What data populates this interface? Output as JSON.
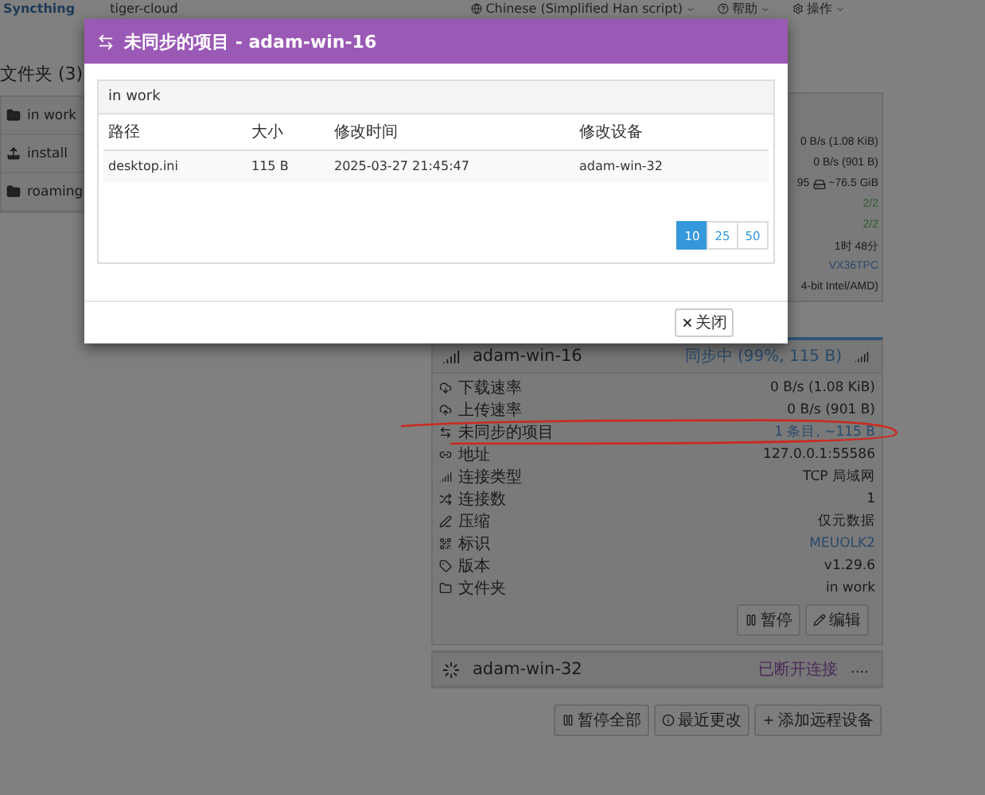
{
  "navbar": {
    "brand": "Syncthing",
    "device_name": "tiger-cloud",
    "language": "Chinese (Simplified Han script)",
    "help": "帮助",
    "actions": "操作"
  },
  "folders": {
    "heading": "文件夹 (3)",
    "items": [
      {
        "name": "in work"
      },
      {
        "name": "install"
      },
      {
        "name": "roaming"
      }
    ]
  },
  "this_device": {
    "values": [
      {
        "text": "0 B/s (1.08 KiB)",
        "kind": "text"
      },
      {
        "text": "0 B/s (901 B)",
        "kind": "text"
      },
      {
        "text": "95",
        "kind": "disk",
        "extra": "~76.5 GiB"
      },
      {
        "text": "2/2",
        "kind": "ok"
      },
      {
        "text": "2/2",
        "kind": "ok"
      },
      {
        "text": "1时 48分",
        "kind": "text"
      },
      {
        "text": "VX36TPC",
        "kind": "link"
      },
      {
        "text": "4-bit Intel/AMD)",
        "kind": "text"
      }
    ]
  },
  "remote_devices": [
    {
      "name": "adam-win-16",
      "status": "同步中 (99%, 115 B)",
      "kind": "syncing",
      "expanded": true,
      "rows": [
        {
          "label": "下载速率",
          "value": "0 B/s (1.08 KiB)",
          "kind": "text"
        },
        {
          "label": "上传速率",
          "value": "0 B/s (901 B)",
          "kind": "text"
        },
        {
          "label": "未同步的项目",
          "value": "1 条目, ~115 B",
          "kind": "link"
        },
        {
          "label": "地址",
          "value": "127.0.0.1:55586",
          "kind": "text"
        },
        {
          "label": "连接类型",
          "value": "TCP 局域网",
          "kind": "text"
        },
        {
          "label": "连接数",
          "value": "1",
          "kind": "text"
        },
        {
          "label": "压缩",
          "value": "仅元数据",
          "kind": "text"
        },
        {
          "label": "标识",
          "value": "MEUOLK2",
          "kind": "link"
        },
        {
          "label": "版本",
          "value": "v1.29.6",
          "kind": "text"
        },
        {
          "label": "文件夹",
          "value": "in work",
          "kind": "text"
        }
      ],
      "buttons": [
        "暂停",
        "编辑"
      ]
    },
    {
      "name": "adam-win-32",
      "status": "已断开连接",
      "kind": "disconnected",
      "expanded": false,
      "more": "...."
    }
  ],
  "device_buttons": [
    "暂停全部",
    "最近更改",
    "添加远程设备"
  ],
  "modal": {
    "title": "未同步的项目 - adam-win-16",
    "folder": "in work",
    "table": {
      "columns": [
        "路径",
        "大小",
        "修改时间",
        "修改设备"
      ],
      "rows": [
        [
          "desktop.ini",
          "115 B",
          "2025-03-27 21:45:47",
          "adam-win-32"
        ]
      ]
    },
    "page_sizes": [
      {
        "label": "10",
        "selected": true
      },
      {
        "label": "25",
        "selected": false
      },
      {
        "label": "50",
        "selected": false
      }
    ],
    "close": "关闭"
  }
}
